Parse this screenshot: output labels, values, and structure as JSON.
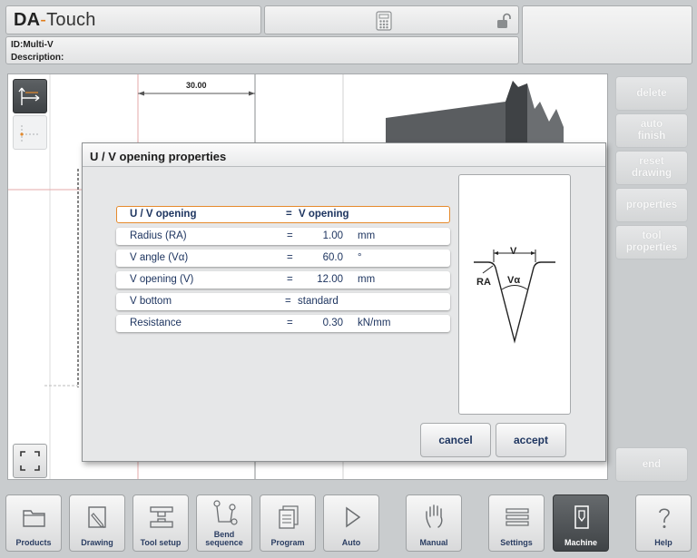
{
  "header": {
    "logo_brand": "DA",
    "logo_sep": "-",
    "logo_product": "Touch",
    "program_id": "ID:Multi-V",
    "description": "Description:"
  },
  "canvas": {
    "dimension_label": "30.00"
  },
  "side_buttons": [
    {
      "label": "delete"
    },
    {
      "label": "auto\nfinish"
    },
    {
      "label": "reset\ndrawing"
    },
    {
      "label": "properties"
    },
    {
      "label": "tool\nproperties"
    },
    {
      "label": "end"
    }
  ],
  "dialog": {
    "title": "U / V opening properties",
    "rows": [
      {
        "label": "U / V opening",
        "eq": "=",
        "value": "V opening",
        "unit": ""
      },
      {
        "label": "Radius (RA)",
        "eq": "=",
        "value": "1.00",
        "unit": "mm"
      },
      {
        "label": "V angle (Vα)",
        "eq": "=",
        "value": "60.0",
        "unit": "°"
      },
      {
        "label": "V opening (V)",
        "eq": "=",
        "value": "12.00",
        "unit": "mm"
      },
      {
        "label": "V bottom",
        "eq": "=",
        "value": "standard",
        "unit": ""
      },
      {
        "label": "Resistance",
        "eq": "=",
        "value": "0.30",
        "unit": "kN/mm"
      }
    ],
    "diagram_labels": {
      "v": "V",
      "ra": "RA",
      "valpha": "Vα"
    },
    "cancel_label": "cancel",
    "accept_label": "accept"
  },
  "nav": [
    {
      "label": "Products",
      "icon": "folder-icon"
    },
    {
      "label": "Drawing",
      "icon": "pencil-icon"
    },
    {
      "label": "Tool setup",
      "icon": "tool-setup-icon"
    },
    {
      "label": "Bend\nsequence",
      "icon": "bend-sequence-icon"
    },
    {
      "label": "Program",
      "icon": "program-icon"
    },
    {
      "label": "Auto",
      "icon": "play-icon"
    },
    {
      "label": "Manual",
      "icon": "hand-icon"
    },
    {
      "label": "Settings",
      "icon": "settings-list-icon"
    },
    {
      "label": "Machine",
      "icon": "machine-icon"
    },
    {
      "label": "Help",
      "icon": "help-icon"
    }
  ],
  "colors": {
    "accent": "#e58a2c",
    "text_blue": "#1e3560",
    "active_nav": "#4a4e51"
  }
}
